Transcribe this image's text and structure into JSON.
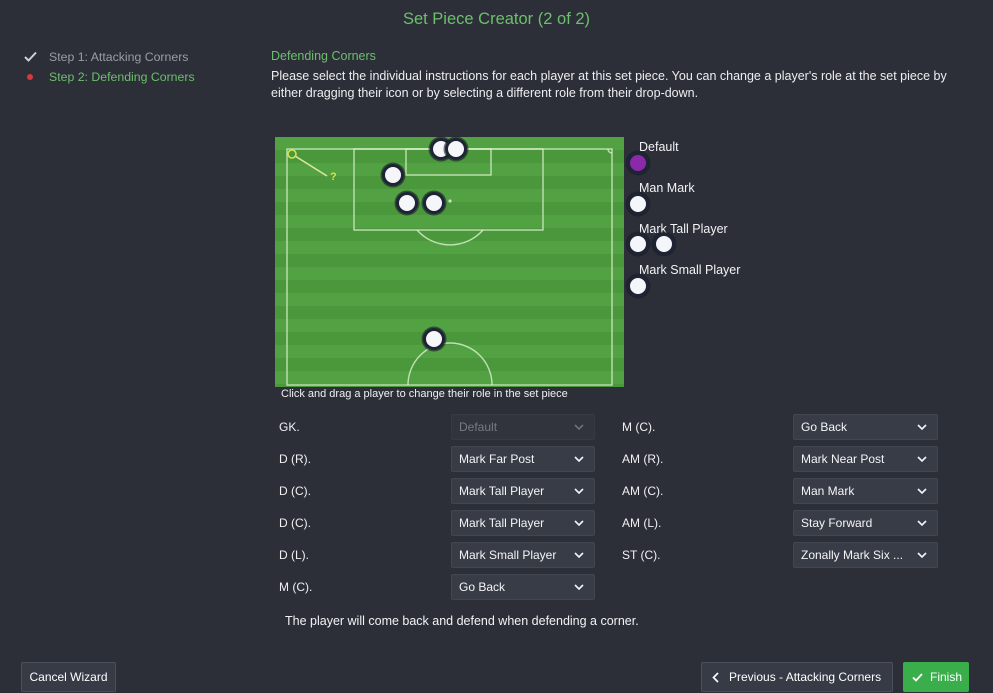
{
  "window": {
    "title": "Set Piece Creator (2 of 2)"
  },
  "steps": [
    {
      "label": "Step 1: Attacking Corners",
      "icon": "check-icon"
    },
    {
      "label": "Step 2: Defending Corners",
      "icon": "current-step-dot-icon"
    }
  ],
  "section": {
    "heading": "Defending Corners",
    "description": "Please select the individual instructions for each player at this set piece. You can change a player's role at the set piece by either dragging their icon or by selecting a different role from their drop-down."
  },
  "pitch": {
    "hint": "Click and drag a player to change their role in the set piece",
    "corner_marker_label": "?"
  },
  "role_legend": [
    "Default",
    "Man Mark",
    "Mark Tall Player",
    "Mark Small Player"
  ],
  "assignments": {
    "left": [
      {
        "position": "GK.",
        "role": "Default",
        "disabled": true
      },
      {
        "position": "D (R).",
        "role": "Mark Far Post"
      },
      {
        "position": "D (C).",
        "role": "Mark Tall Player"
      },
      {
        "position": "D (C).",
        "role": "Mark Tall Player"
      },
      {
        "position": "D (L).",
        "role": "Mark Small Player"
      },
      {
        "position": "M (C).",
        "role": "Go Back"
      }
    ],
    "right": [
      {
        "position": "M (C).",
        "role": "Go Back"
      },
      {
        "position": "AM (R).",
        "role": "Mark Near Post"
      },
      {
        "position": "AM (C).",
        "role": "Man Mark"
      },
      {
        "position": "AM (L).",
        "role": "Stay Forward"
      },
      {
        "position": "ST (C).",
        "role": "Zonally Mark Six ..."
      }
    ]
  },
  "role_description": "The player will come back and defend when defending a corner.",
  "buttons": {
    "cancel": {
      "label": "Cancel Wizard"
    },
    "previous": {
      "label": "Previous - Attacking Corners",
      "icon": "chevron-left-icon"
    },
    "finish": {
      "label": "Finish",
      "icon": "check-icon"
    }
  },
  "icons": {
    "dropdown": "chevron-down-icon",
    "player": "player-token-icon"
  },
  "colors": {
    "background": "#2c2f38",
    "title_green": "#6cbf6c",
    "current_step_dot": "#d9363e",
    "pitch_green": "#52a142",
    "default_role_token": "#8b2aa9",
    "finish_button": "#3aae4b",
    "corner_marker": "#e6df3a"
  }
}
